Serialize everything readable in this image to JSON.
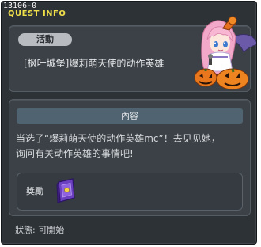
{
  "window": {
    "quest_id": "13106-0",
    "title": "QUEST INFO"
  },
  "activity": {
    "tag_label": "活動",
    "quest_name": "[枫叶城堡]爆莉萌天使的动作英雄"
  },
  "content": {
    "header": "內容",
    "description": "当选了“爆莉萌天使的动作英雄mc”！去见见她，\n询问有关动作英雄的事情吧!"
  },
  "reward": {
    "label": "獎勵",
    "item_icon": "purple-book-icon"
  },
  "status": {
    "text": "狀態: 可開始"
  },
  "colors": {
    "window_bg": "#2d3237",
    "panel_bg": "#3b4147",
    "title_yellow": "#f0e04a",
    "header_bar": "#4f6470",
    "pill_bg": "#b8bcc0"
  }
}
